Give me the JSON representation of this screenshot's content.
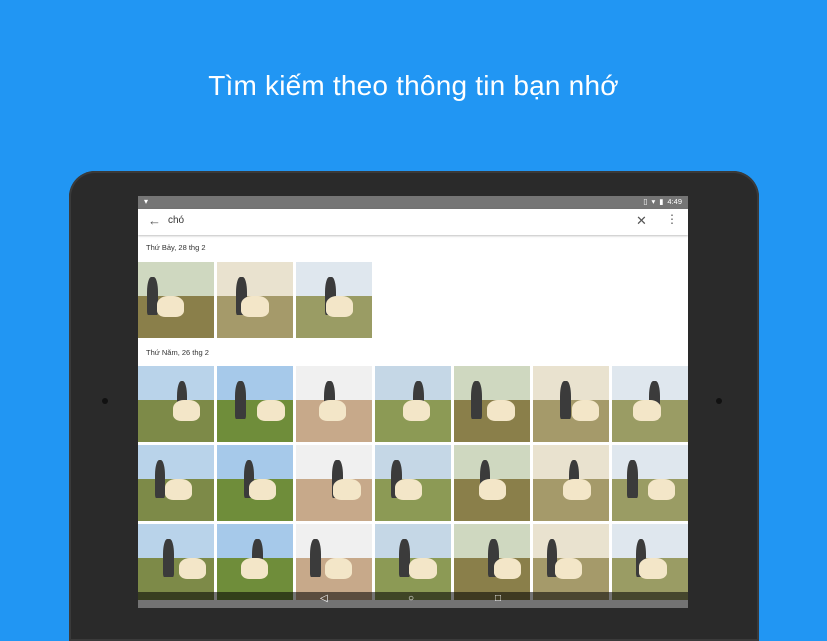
{
  "headline": "Tìm kiếm theo thông tin bạn nhớ",
  "statusbar": {
    "time": "4:49"
  },
  "search": {
    "query": "chó"
  },
  "sections": [
    {
      "date": "Thứ Bảy, 28 thg 2",
      "count": 3
    },
    {
      "date": "Thứ Năm, 26 thg 2",
      "count": 21
    }
  ],
  "colors": {
    "background": "#2196f3",
    "statusbar": "#757575"
  }
}
